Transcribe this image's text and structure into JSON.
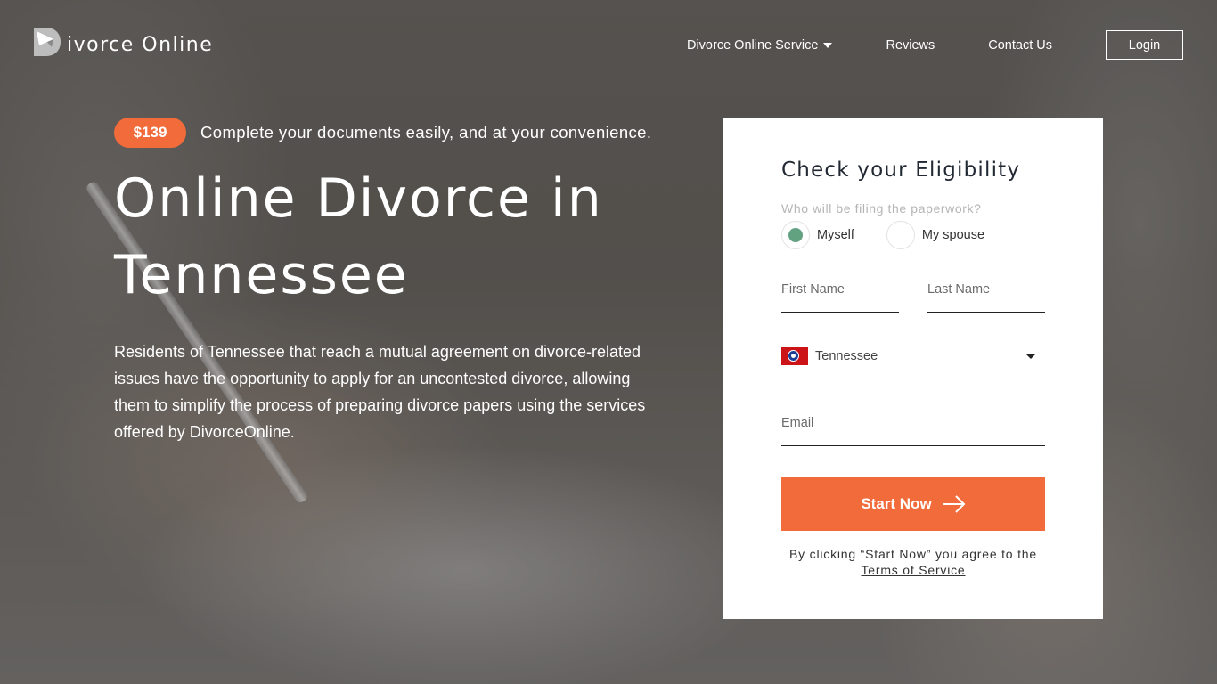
{
  "brand": {
    "logo_letter_icon": "d-logo-icon",
    "name": "ivorce Online",
    "accent_color": "#f26b3a",
    "radio_selected_color": "#62a281"
  },
  "nav": {
    "items": [
      {
        "label": "Divorce Online Service",
        "has_dropdown": true
      },
      {
        "label": "Reviews",
        "has_dropdown": false
      },
      {
        "label": "Contact Us",
        "has_dropdown": false
      }
    ],
    "login_label": "Login"
  },
  "hero": {
    "price": "$139",
    "tagline": "Complete your documents easily, and at your convenience.",
    "title_line1": "Online Divorce in",
    "title_line2": "Tennessee",
    "description": "Residents of Tennessee that reach a mutual agreement on divorce-related issues have the opportunity to apply for an uncontested divorce, allowing them to simplify the process of preparing divorce papers using the services offered by DivorceOnline."
  },
  "form": {
    "title": "Check your Eligibility",
    "question": "Who will be filing the paperwork?",
    "options": [
      {
        "label": "Myself",
        "selected": true
      },
      {
        "label": "My spouse",
        "selected": false
      }
    ],
    "first_name_placeholder": "First Name",
    "first_name_value": "",
    "last_name_placeholder": "Last Name",
    "last_name_value": "",
    "state_selected": "Tennessee",
    "state_flag_icon": "tennessee-flag-icon",
    "email_placeholder": "Email",
    "email_value": "",
    "submit_label": "Start Now",
    "agree_text": "By clicking “Start Now” you agree to the",
    "terms_link": "Terms of Service"
  }
}
